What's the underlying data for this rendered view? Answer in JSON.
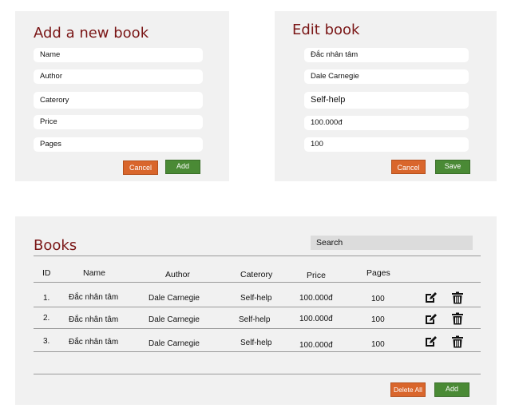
{
  "add_form": {
    "title": "Add a new book",
    "placeholders": [
      "Name",
      "Author",
      "Caterory",
      "Price",
      "Pages"
    ],
    "cancel_label": "Cancel",
    "add_label": "Add"
  },
  "edit_form": {
    "title": "Edit book",
    "values": [
      "Đắc nhân tâm",
      "Dale Carnegie",
      "Self-help",
      "100.000đ",
      "100"
    ],
    "cancel_label": "Cancel",
    "save_label": "Save"
  },
  "books": {
    "title": "Books",
    "search_placeholder": "Search",
    "columns": [
      "ID",
      "Name",
      "Author",
      "Caterory",
      "Price",
      "Pages"
    ],
    "rows": [
      {
        "id": "1.",
        "name": "Đắc nhân tâm",
        "author": "Dale Carnegie",
        "category": "Self-help",
        "price": "100.000đ",
        "pages": "100"
      },
      {
        "id": "2.",
        "name": "Đắc nhân tâm",
        "author": "Dale Carnegie",
        "category": "Self-help",
        "price": "100.000đ",
        "pages": "100"
      },
      {
        "id": "3.",
        "name": "Đắc nhân tâm",
        "author": "Dale Carnegie",
        "category": "Self-help",
        "price": "100.000đ",
        "pages": "100"
      }
    ],
    "delete_all_label": "Delete All",
    "add_label": "Add",
    "row_icons": [
      "edit-icon",
      "trash-icon"
    ]
  },
  "colors": {
    "title": "#7a1616",
    "panel_bg": "#f1f1f1",
    "cancel": "#d9662c",
    "confirm": "#4a8a35"
  }
}
